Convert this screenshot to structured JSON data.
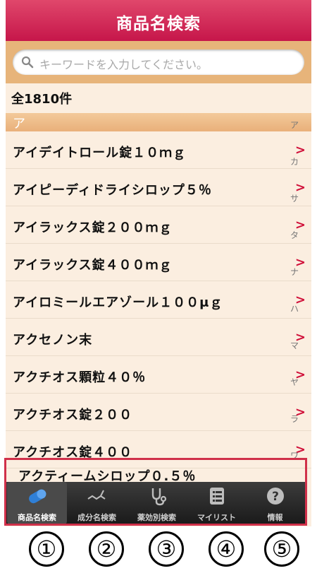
{
  "header": {
    "title": "商品名検索"
  },
  "search": {
    "placeholder": "キーワードを入力してください。"
  },
  "count_label": "全1810件",
  "section_label": "ア",
  "items": [
    {
      "name": "アイデイトロール錠１０ｍｇ"
    },
    {
      "name": "アイピーディドライシロップ５％"
    },
    {
      "name": "アイラックス錠２００ｍｇ"
    },
    {
      "name": "アイラックス錠４００ｍｇ"
    },
    {
      "name": "アイロミールエアゾール１００μｇ"
    },
    {
      "name": "アクセノン末"
    },
    {
      "name": "アクチオス顆粒４０％"
    },
    {
      "name": "アクチオス錠２００"
    },
    {
      "name": "アクチオス錠４００"
    }
  ],
  "peek_item": "アクティームシロップ０.５％",
  "index": [
    "ア",
    "カ",
    "サ",
    "タ",
    "ナ",
    "ハ",
    "マ",
    "ヤ",
    "ラ",
    "ワ"
  ],
  "tabs": [
    {
      "label": "商品名検索",
      "icon": "pill-icon",
      "selected": true
    },
    {
      "label": "成分名検索",
      "icon": "molecule-icon",
      "selected": false
    },
    {
      "label": "薬効別検索",
      "icon": "stethoscope-icon",
      "selected": false
    },
    {
      "label": "マイリスト",
      "icon": "list-icon",
      "selected": false
    },
    {
      "label": "情報",
      "icon": "question-icon",
      "selected": false
    }
  ],
  "annotations": [
    "①",
    "②",
    "③",
    "④",
    "⑤"
  ],
  "colors": {
    "accent": "#d0103a",
    "header": "#c6164a",
    "search_bar": "#e7b47a",
    "background": "#fbeee0"
  }
}
